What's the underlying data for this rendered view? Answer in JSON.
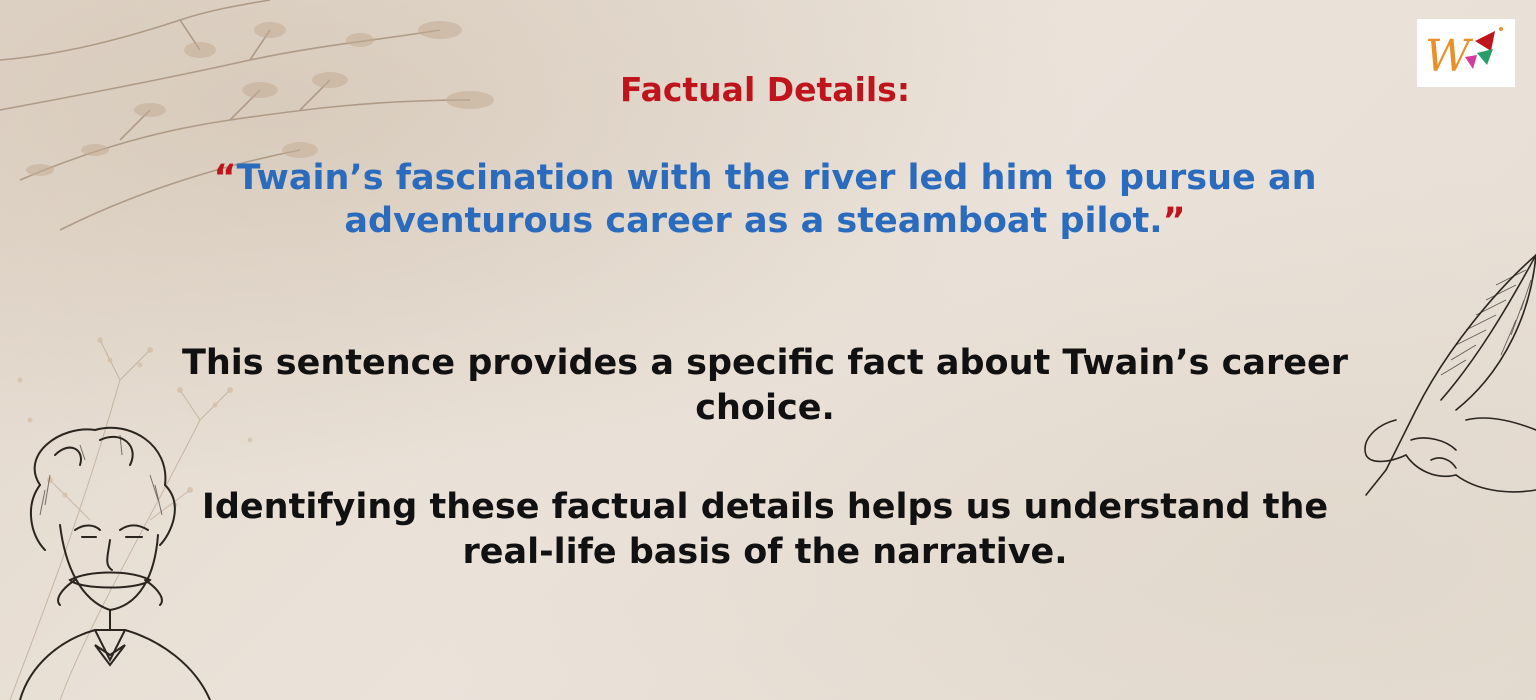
{
  "logo": {
    "icon": "w-letter-logo",
    "colors": [
      "#e8902a",
      "#c0141c",
      "#2a9d6a",
      "#d53a9d"
    ]
  },
  "slide": {
    "heading": "Factual Details:",
    "quote": {
      "open_mark": "“",
      "line1": "Twain’s fascination with the river led him to pursue an",
      "line2": "adventurous career as a steamboat pilot.",
      "close_mark": "”"
    },
    "paragraph1": {
      "line1": "This sentence provides a specific fact about Twain’s career",
      "line2": "choice."
    },
    "paragraph2": {
      "line1": "Identifying these factual details helps us understand the",
      "line2": "real-life basis of the narrative."
    }
  },
  "colors": {
    "heading": "#c0141c",
    "quote": "#2a6bbd",
    "body": "#111111",
    "background": "#e9e0d7"
  }
}
